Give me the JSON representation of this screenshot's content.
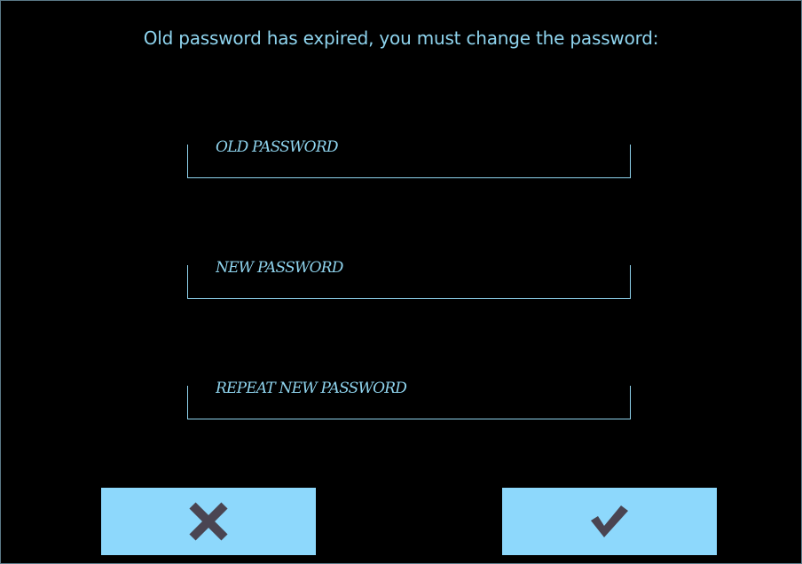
{
  "dialog": {
    "message": "Old password has expired, you must change the password:"
  },
  "fields": {
    "old_password": {
      "placeholder": "OLD PASSWORD",
      "value": ""
    },
    "new_password": {
      "placeholder": "NEW PASSWORD",
      "value": ""
    },
    "repeat_new_password": {
      "placeholder": "REPEAT NEW PASSWORD",
      "value": ""
    }
  },
  "buttons": {
    "cancel": {
      "icon": "close-icon"
    },
    "confirm": {
      "icon": "checkmark-icon"
    }
  },
  "colors": {
    "background": "#000000",
    "accent": "#8fd4ee",
    "button": "#8dd8fc",
    "icon": "#4a4552"
  }
}
